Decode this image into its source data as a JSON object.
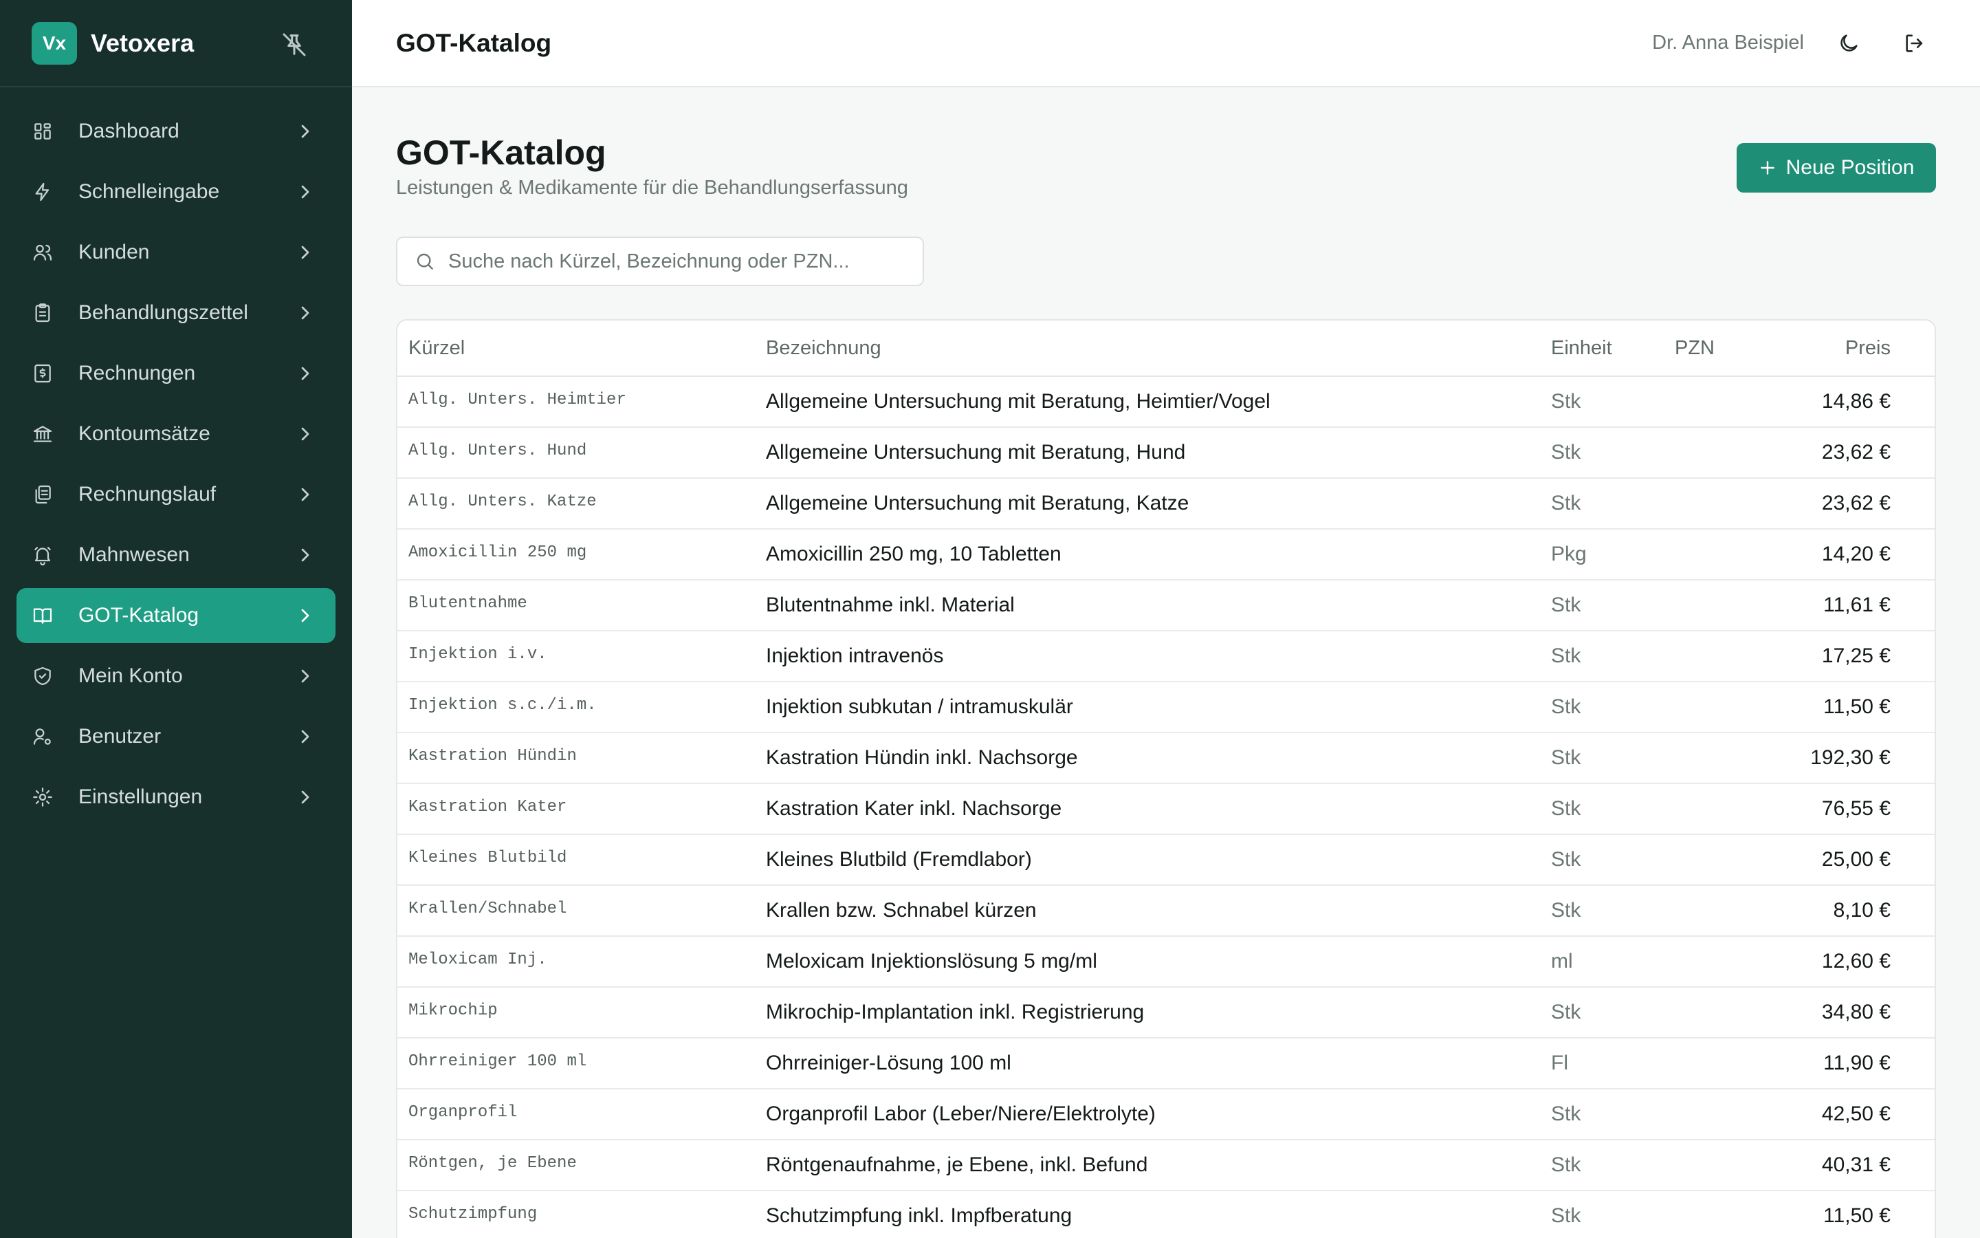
{
  "brand": {
    "logo_text": "Vx",
    "name": "Vetoxera"
  },
  "sidebar": {
    "items": [
      {
        "label": "Dashboard",
        "icon": "dashboard-icon",
        "active": false
      },
      {
        "label": "Schnelleingabe",
        "icon": "lightning-icon",
        "active": false
      },
      {
        "label": "Kunden",
        "icon": "users-icon",
        "active": false
      },
      {
        "label": "Behandlungszettel",
        "icon": "clipboard-icon",
        "active": false
      },
      {
        "label": "Rechnungen",
        "icon": "invoice-icon",
        "active": false
      },
      {
        "label": "Kontoumsätze",
        "icon": "bank-icon",
        "active": false
      },
      {
        "label": "Rechnungslauf",
        "icon": "documents-icon",
        "active": false
      },
      {
        "label": "Mahnwesen",
        "icon": "bell-icon",
        "active": false
      },
      {
        "label": "GOT-Katalog",
        "icon": "book-icon",
        "active": true
      },
      {
        "label": "Mein Konto",
        "icon": "shield-icon",
        "active": false
      },
      {
        "label": "Benutzer",
        "icon": "user-gear-icon",
        "active": false
      },
      {
        "label": "Einstellungen",
        "icon": "gear-icon",
        "active": false
      }
    ]
  },
  "header": {
    "title": "GOT-Katalog",
    "user": "Dr. Anna Beispiel"
  },
  "main": {
    "title": "GOT-Katalog",
    "subtitle": "Leistungen & Medikamente für die Behandlungserfassung",
    "new_button": "Neue Position",
    "search_placeholder": "Suche nach Kürzel, Bezeichnung oder PZN..."
  },
  "table": {
    "headers": {
      "kurzel": "Kürzel",
      "bezeichnung": "Bezeichnung",
      "einheit": "Einheit",
      "pzn": "PZN",
      "preis": "Preis"
    },
    "rows": [
      {
        "code": "Allg. Unters. Heimtier",
        "name": "Allgemeine Untersuchung mit Beratung, Heimtier/Vogel",
        "unit": "Stk",
        "pzn": "",
        "price": "14,86 €"
      },
      {
        "code": "Allg. Unters. Hund",
        "name": "Allgemeine Untersuchung mit Beratung, Hund",
        "unit": "Stk",
        "pzn": "",
        "price": "23,62 €"
      },
      {
        "code": "Allg. Unters. Katze",
        "name": "Allgemeine Untersuchung mit Beratung, Katze",
        "unit": "Stk",
        "pzn": "",
        "price": "23,62 €"
      },
      {
        "code": "Amoxicillin 250 mg",
        "name": "Amoxicillin 250 mg, 10 Tabletten",
        "unit": "Pkg",
        "pzn": "",
        "price": "14,20 €"
      },
      {
        "code": "Blutentnahme",
        "name": "Blutentnahme inkl. Material",
        "unit": "Stk",
        "pzn": "",
        "price": "11,61 €"
      },
      {
        "code": "Injektion i.v.",
        "name": "Injektion intravenös",
        "unit": "Stk",
        "pzn": "",
        "price": "17,25 €"
      },
      {
        "code": "Injektion s.c./i.m.",
        "name": "Injektion subkutan / intramuskulär",
        "unit": "Stk",
        "pzn": "",
        "price": "11,50 €"
      },
      {
        "code": "Kastration Hündin",
        "name": "Kastration Hündin inkl. Nachsorge",
        "unit": "Stk",
        "pzn": "",
        "price": "192,30 €"
      },
      {
        "code": "Kastration Kater",
        "name": "Kastration Kater inkl. Nachsorge",
        "unit": "Stk",
        "pzn": "",
        "price": "76,55 €"
      },
      {
        "code": "Kleines Blutbild",
        "name": "Kleines Blutbild (Fremdlabor)",
        "unit": "Stk",
        "pzn": "",
        "price": "25,00 €"
      },
      {
        "code": "Krallen/Schnabel",
        "name": "Krallen bzw. Schnabel kürzen",
        "unit": "Stk",
        "pzn": "",
        "price": "8,10 €"
      },
      {
        "code": "Meloxicam Inj.",
        "name": "Meloxicam Injektionslösung 5 mg/ml",
        "unit": "ml",
        "pzn": "",
        "price": "12,60 €"
      },
      {
        "code": "Mikrochip",
        "name": "Mikrochip-Implantation inkl. Registrierung",
        "unit": "Stk",
        "pzn": "",
        "price": "34,80 €"
      },
      {
        "code": "Ohrreiniger 100 ml",
        "name": "Ohrreiniger-Lösung 100 ml",
        "unit": "Fl",
        "pzn": "",
        "price": "11,90 €"
      },
      {
        "code": "Organprofil",
        "name": "Organprofil Labor (Leber/Niere/Elektrolyte)",
        "unit": "Stk",
        "pzn": "",
        "price": "42,50 €"
      },
      {
        "code": "Röntgen, je Ebene",
        "name": "Röntgenaufnahme, je Ebene, inkl. Befund",
        "unit": "Stk",
        "pzn": "",
        "price": "40,31 €"
      },
      {
        "code": "Schutzimpfung",
        "name": "Schutzimpfung inkl. Impfberatung",
        "unit": "Stk",
        "pzn": "",
        "price": "11,50 €"
      }
    ]
  },
  "colors": {
    "sidebar_bg": "#17302c",
    "accent": "#1e9e84",
    "button": "#1e8e76"
  }
}
